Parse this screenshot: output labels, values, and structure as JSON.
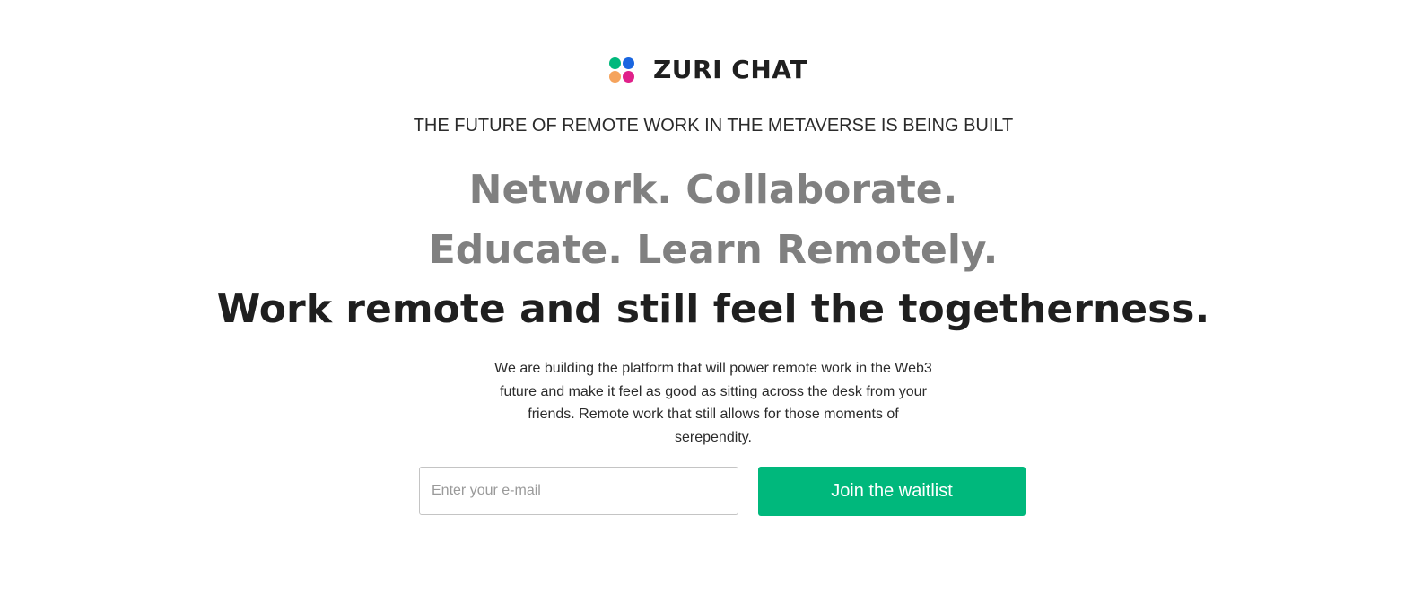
{
  "brand": {
    "name": "ZURI CHAT",
    "logo_icon": "four-dots-logo-icon",
    "logo_colors": {
      "top_left": "#00b87c",
      "top_right": "#1a66e0",
      "bottom_left": "#f5a35c",
      "bottom_right": "#e0218a"
    }
  },
  "hero": {
    "tagline": "THE FUTURE OF REMOTE WORK IN THE METAVERSE IS BEING BUILT",
    "headline_line1": "Network. Collaborate.",
    "headline_line2": "Educate. Learn Remotely.",
    "headline_line3": "Work remote and still feel the togetherness.",
    "description": "We are building the platform that will power remote work in the Web3 future and make it feel as good as sitting across the desk from your friends. Remote work that still allows for those moments of serependity."
  },
  "waitlist": {
    "email_placeholder": "Enter your e-mail",
    "email_value": "",
    "button_label": "Join the waitlist"
  },
  "colors": {
    "accent": "#00b87c",
    "headline_gray": "#808080",
    "headline_dark": "#1f1f1f"
  }
}
